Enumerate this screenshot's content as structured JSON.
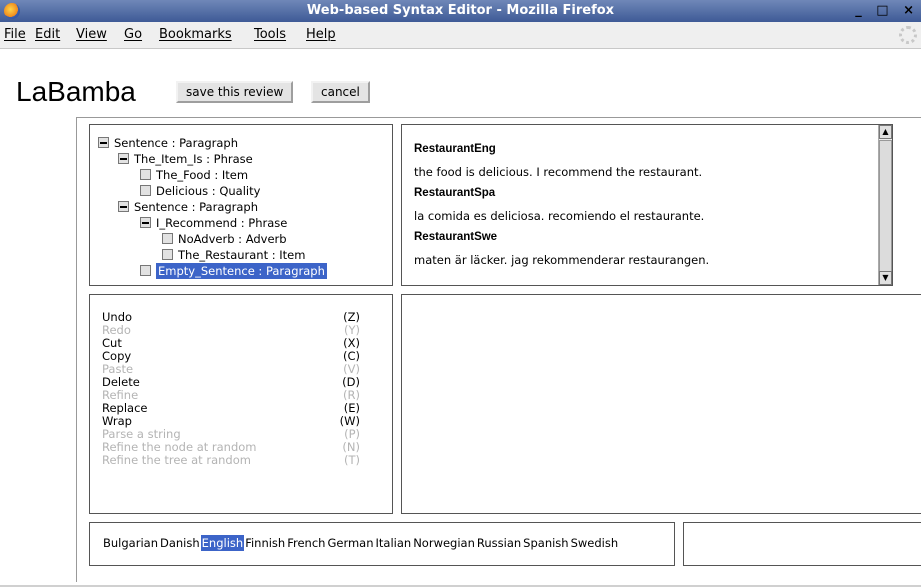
{
  "window": {
    "title": "Web-based Syntax Editor - Mozilla Firefox",
    "controls": "_ □ ×"
  },
  "menubar": {
    "items": [
      "File",
      "Edit",
      "View",
      "Go",
      "Bookmarks",
      "Tools",
      "Help"
    ]
  },
  "header": {
    "title": "LaBamba",
    "save_label": "save this review",
    "cancel_label": "cancel"
  },
  "tree": {
    "nodes": [
      {
        "label": "Sentence : Paragraph",
        "expanded": true
      },
      {
        "label": "The_Item_Is : Phrase",
        "expanded": true
      },
      {
        "label": "The_Food : Item",
        "expanded": false
      },
      {
        "label": "Delicious : Quality",
        "expanded": false
      },
      {
        "label": "Sentence : Paragraph",
        "expanded": true
      },
      {
        "label": "I_Recommend : Phrase",
        "expanded": true
      },
      {
        "label": "NoAdverb : Adverb",
        "expanded": false
      },
      {
        "label": "The_Restaurant : Item",
        "expanded": false
      },
      {
        "label": "Empty_Sentence : Paragraph",
        "expanded": false,
        "selected": true
      }
    ]
  },
  "linearizations": [
    {
      "name": "RestaurantEng",
      "text": "the food is delicious.  I recommend the restaurant."
    },
    {
      "name": "RestaurantSpa",
      "text": "la comida es deliciosa.  recomiendo el restaurante."
    },
    {
      "name": "RestaurantSwe",
      "text": "maten är läcker.  jag rekommenderar restaurangen."
    }
  ],
  "commands": [
    {
      "label": "Undo",
      "key": "(Z)",
      "enabled": true
    },
    {
      "label": "Redo",
      "key": "(Y)",
      "enabled": false
    },
    {
      "label": "Cut",
      "key": "(X)",
      "enabled": true
    },
    {
      "label": "Copy",
      "key": "(C)",
      "enabled": true
    },
    {
      "label": "Paste",
      "key": "(V)",
      "enabled": false
    },
    {
      "label": "Delete",
      "key": "(D)",
      "enabled": true
    },
    {
      "label": "Refine",
      "key": "(R)",
      "enabled": false
    },
    {
      "label": "Replace",
      "key": "(E)",
      "enabled": true
    },
    {
      "label": "Wrap",
      "key": "(W)",
      "enabled": true
    },
    {
      "label": "Parse a string",
      "key": "(P)",
      "enabled": false
    },
    {
      "label": "Refine the node at random",
      "key": "(N)",
      "enabled": false
    },
    {
      "label": "Refine the tree at random",
      "key": "(T)",
      "enabled": false
    }
  ],
  "languages": {
    "items": [
      "Bulgarian",
      "Danish",
      "English",
      "Finnish",
      "French",
      "German",
      "Italian",
      "Norwegian",
      "Russian",
      "Spanish",
      "Swedish"
    ],
    "selected": "English"
  },
  "colors": {
    "selection": "#3c64c8",
    "disabled_text": "#b4b4b4"
  }
}
